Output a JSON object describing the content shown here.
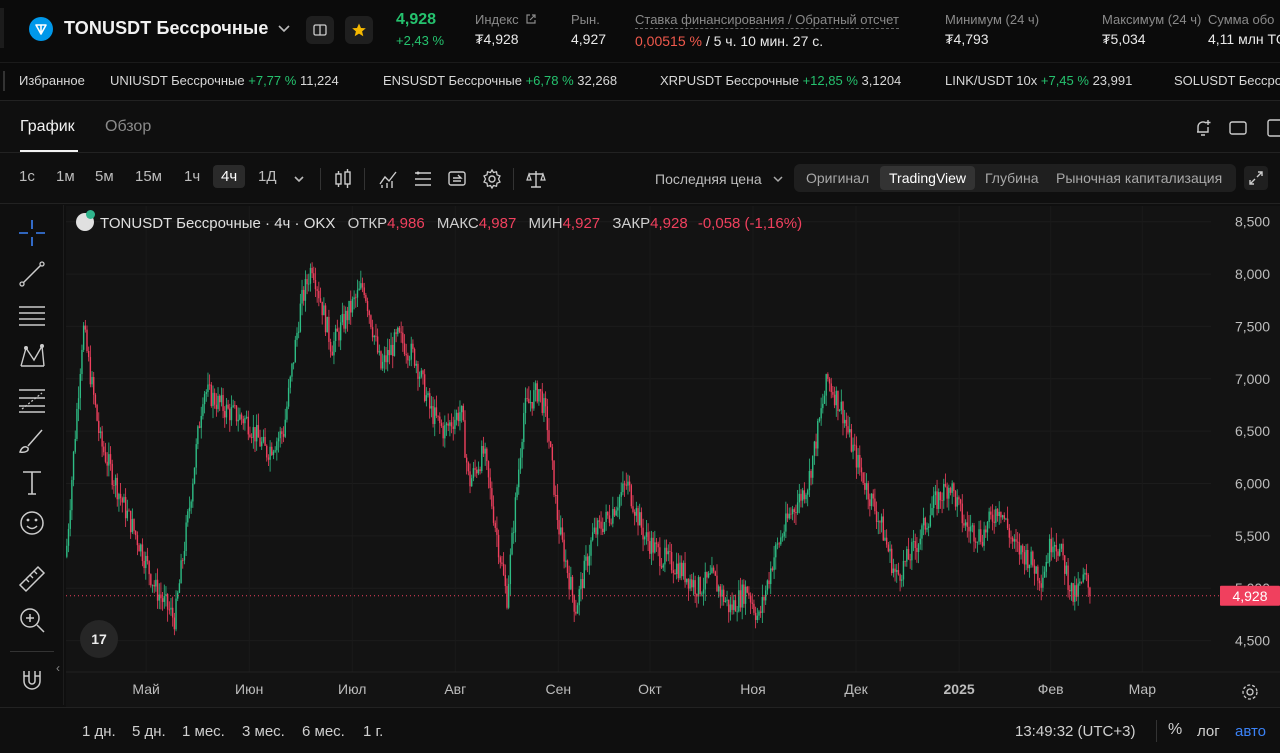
{
  "header": {
    "symbol": "TONUSDT Бессрочные",
    "price": "4,928",
    "change": "+2,43 %",
    "index_label": "Индекс",
    "index_value": "₮4,928",
    "market_label": "Рын.",
    "market_value": "4,927",
    "funding_label": "Ставка финансирования / Обратный отсчет",
    "funding_rate": "0,00515 %",
    "funding_countdown": " / 5 ч. 10 мин. 27 с.",
    "low_label": "Минимум (24 ч)",
    "low_value": "₮4,793",
    "high_label": "Максимум (24 ч)",
    "high_value": "₮5,034",
    "sum_label": "Сумма обо",
    "sum_value": "4,11 млн TO"
  },
  "ticker": {
    "favorites_label": "Избранное",
    "items": [
      {
        "name": "UNIUSDT Бессрочные",
        "pct": "+7,77 %",
        "value": "11,224"
      },
      {
        "name": "ENSUSDT Бессрочные",
        "pct": "+6,78 %",
        "value": "32,268"
      },
      {
        "name": "XRPUSDT Бессрочные",
        "pct": "+12,85 %",
        "value": "3,1204"
      },
      {
        "name": "LINK/USDT 10x",
        "pct": "+7,45 %",
        "value": "23,991"
      },
      {
        "name": "SOLUSDT Бессро",
        "pct": "",
        "value": ""
      }
    ]
  },
  "tabs": {
    "chart": "График",
    "overview": "Обзор"
  },
  "toolbar": {
    "timeframes": [
      "1с",
      "1м",
      "5м",
      "15м",
      "1ч",
      "4ч",
      "1Д"
    ],
    "active_timeframe": "4ч",
    "price_type": "Последняя цена",
    "views": [
      "Оригинал",
      "TradingView",
      "Глубина",
      "Рыночная капитализация"
    ],
    "active_view": "TradingView"
  },
  "legend": {
    "title": "TONUSDT Бессрочные · 4ч · OKX",
    "open_label": "ОТКР",
    "open": "4,986",
    "high_label": "МАКС",
    "high": "4,987",
    "low_label": "МИН",
    "low": "4,927",
    "close_label": "ЗАКР",
    "close": "4,928",
    "change": "-0,058 (-1,16%)"
  },
  "tv_logo": "17",
  "bottom": {
    "ranges": [
      "1 дн.",
      "5 дн.",
      "1 мес.",
      "3 мес.",
      "6 мес.",
      "1 г."
    ],
    "time": "13:49:32 (UTC+3)",
    "percent": "%",
    "log": "лог",
    "auto": "авто"
  },
  "chart_data": {
    "type": "candlestick",
    "interval": "4h",
    "y_ticks": [
      "8,500",
      "8,000",
      "7,500",
      "7,000",
      "6,500",
      "6,000",
      "5,500",
      "5,000",
      "4,500"
    ],
    "ylim": [
      4.2,
      8.65
    ],
    "x_ticks": [
      "Май",
      "Июн",
      "Июл",
      "Авг",
      "Сен",
      "Окт",
      "Ноя",
      "Дек",
      "2025",
      "Фев",
      "Мар"
    ],
    "x_tick_positions": [
      0.07,
      0.16,
      0.25,
      0.34,
      0.43,
      0.51,
      0.6,
      0.69,
      0.78,
      0.86,
      0.94
    ],
    "last_price": "4,928",
    "last_price_value": 4.928,
    "up_color": "#2ebd85",
    "down_color": "#f0405e",
    "trajectory_x": [
      0,
      0.015,
      0.03,
      0.05,
      0.065,
      0.078,
      0.095,
      0.108,
      0.12,
      0.14,
      0.158,
      0.175,
      0.19,
      0.205,
      0.215,
      0.232,
      0.245,
      0.26,
      0.275,
      0.29,
      0.305,
      0.318,
      0.33,
      0.345,
      0.352,
      0.365,
      0.385,
      0.4,
      0.413,
      0.42,
      0.43,
      0.445,
      0.46,
      0.475,
      0.49,
      0.505,
      0.52,
      0.535,
      0.552,
      0.565,
      0.58,
      0.595,
      0.605,
      0.618,
      0.632,
      0.648,
      0.665,
      0.678,
      0.685,
      0.698,
      0.712,
      0.725,
      0.742,
      0.758,
      0.772,
      0.785,
      0.8,
      0.815,
      0.828,
      0.84,
      0.852,
      0.862,
      0.87,
      0.88,
      0.89,
      0.895
    ],
    "trajectory_y": [
      5.3,
      7.5,
      6.4,
      5.8,
      5.4,
      5.0,
      4.7,
      5.8,
      6.9,
      6.7,
      6.6,
      6.3,
      6.5,
      7.7,
      8.1,
      7.3,
      7.6,
      7.9,
      7.1,
      7.4,
      7.2,
      6.7,
      6.5,
      6.7,
      6.0,
      6.3,
      4.9,
      6.7,
      6.9,
      6.6,
      5.6,
      4.8,
      5.5,
      5.7,
      6.0,
      5.5,
      5.3,
      5.2,
      5.0,
      5.1,
      4.8,
      5.0,
      4.7,
      5.3,
      5.7,
      6.0,
      7.0,
      6.7,
      6.4,
      6.0,
      5.6,
      5.1,
      5.4,
      5.8,
      6.0,
      5.6,
      5.5,
      5.8,
      5.4,
      5.3,
      5.1,
      5.5,
      5.3,
      4.9,
      5.1,
      4.93
    ]
  }
}
